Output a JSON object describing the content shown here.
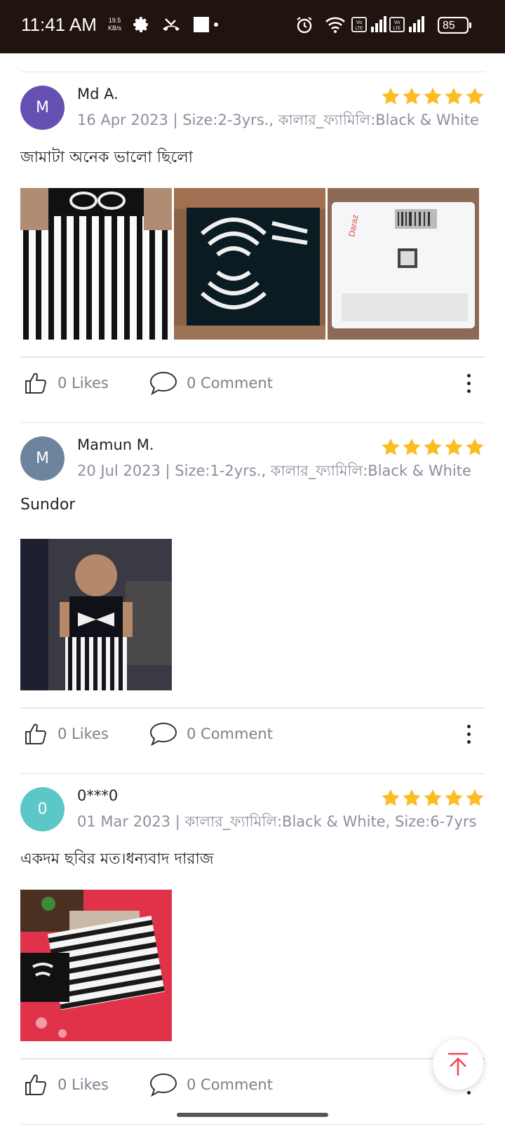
{
  "status_bar": {
    "time": "11:41 AM",
    "speed_value": "19.5",
    "speed_unit": "KB/s",
    "battery": "85",
    "icons": [
      "settings-icon",
      "missed-call-icon",
      "screen-record-icon",
      "alarm-icon",
      "wifi-icon",
      "volte-signal-icon",
      "signal-icon",
      "volte-signal-icon",
      "signal-icon",
      "battery-icon"
    ]
  },
  "reviews": [
    {
      "avatar_letter": "M",
      "avatar_color": "#6651b3",
      "name": "Md A.",
      "meta": "16 Apr 2023 | Size:2-3yrs., কালার_ফ্যামিলি:Black & White",
      "rating": 5,
      "text": "জামাটা অনেক  ভালো ছিলো",
      "photos": [
        "striped dress with bow",
        "dark packaged dress",
        "white Daraz parcel"
      ],
      "likes_label": "0 Likes",
      "comment_label": "0 Comment"
    },
    {
      "avatar_letter": "M",
      "avatar_color": "#6d849f",
      "name": "Mamun M.",
      "meta": "20 Jul 2023 | Size:1-2yrs., কালার_ফ্যামিলি:Black & White",
      "rating": 5,
      "text": "Sundor",
      "photos": [
        "child wearing striped dress"
      ],
      "likes_label": "0 Likes",
      "comment_label": "0 Comment"
    },
    {
      "avatar_letter": "0",
      "avatar_color": "#5bc7c7",
      "name": "0***0",
      "meta": "01 Mar 2023 | কালার_ফ্যামিলি:Black & White, Size:6-7yrs",
      "rating": 5,
      "text": "একদম ছবির মত।ধন্যবাদ দারাজ",
      "photos": [
        "striped dress on red bedsheet"
      ],
      "likes_label": "0 Likes",
      "comment_label": "0 Comment"
    }
  ],
  "colors": {
    "star": "#fbbd23",
    "accent": "#f0465c",
    "meta_text": "#8c8f9e",
    "status_bar_bg": "#21130e"
  }
}
